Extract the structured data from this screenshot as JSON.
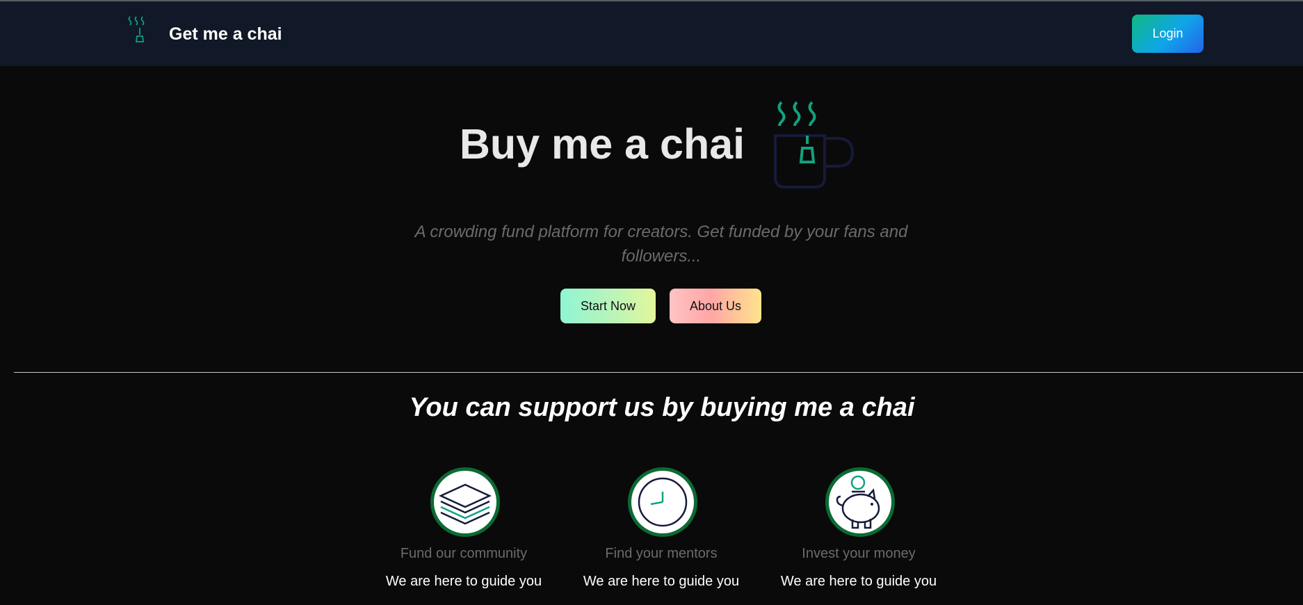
{
  "navbar": {
    "brand_icon": "tea-mug-icon",
    "brand_title": "Get me a chai",
    "login_label": "Login"
  },
  "hero": {
    "title": "Buy me a chai",
    "icon": "chai-cup-icon",
    "subtitle": "A crowding fund platform for creators. Get funded by your fans and followers...",
    "start_label": "Start Now",
    "about_label": "About Us"
  },
  "support": {
    "title": "You can support us by buying me a chai",
    "features": [
      {
        "icon": "layers-icon",
        "title": "Fund our community",
        "desc": "We are here to guide you"
      },
      {
        "icon": "clock-icon",
        "title": "Find your mentors",
        "desc": "We are here to guide you"
      },
      {
        "icon": "piggy-bank-icon",
        "title": "Invest your money",
        "desc": "We are here to guide you"
      }
    ]
  },
  "colors": {
    "nav_bg": "#111827",
    "page_bg": "#0a0a0a",
    "accent_teal": "#10a37f",
    "circle_border": "#0b6b33"
  }
}
